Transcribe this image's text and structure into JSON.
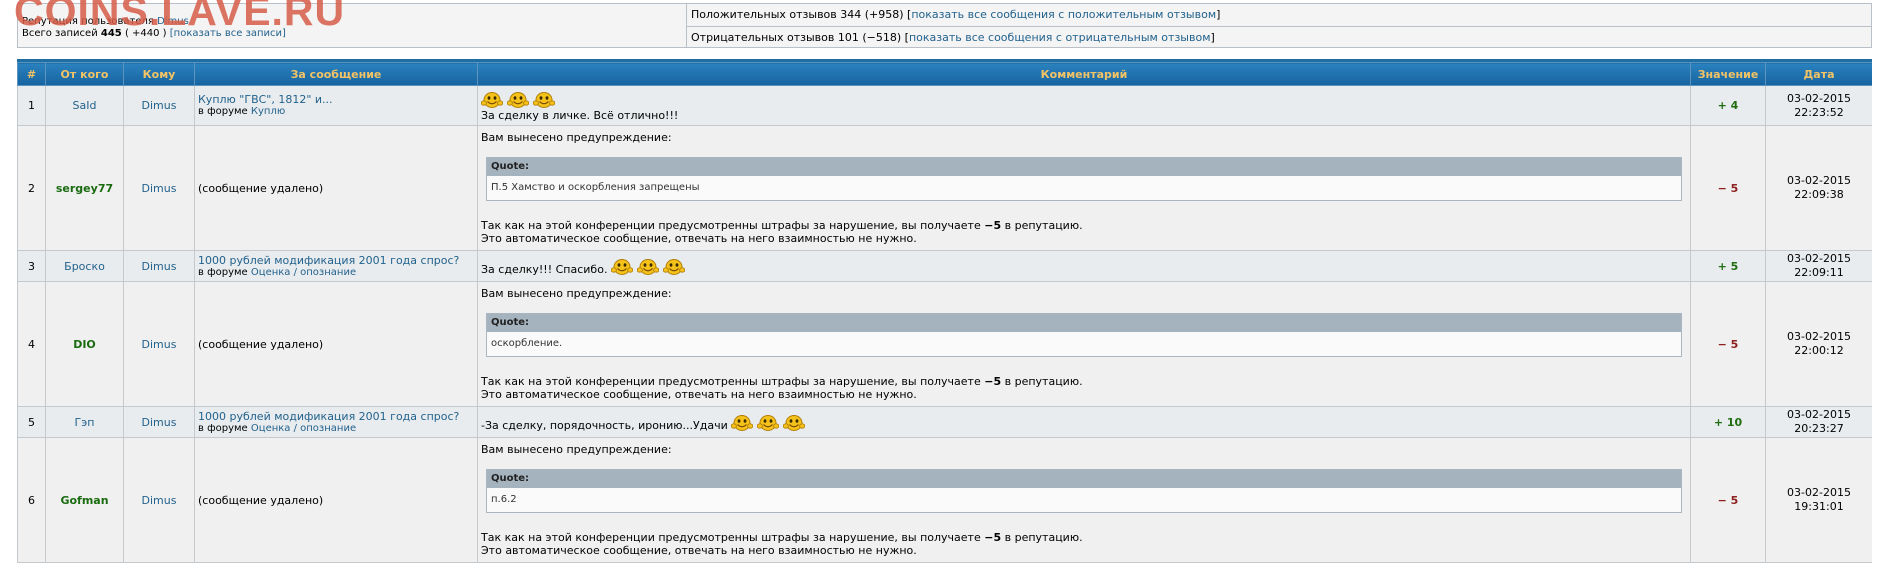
{
  "watermark": "COINS.LAVE.RU",
  "summary": {
    "reputation_label": "Репутация пользователя",
    "reputation_user": "Dimus",
    "total_label": "Всего записей",
    "total_count": "445",
    "total_delta": "( +440 )",
    "show_all_link": "[показать все записи]",
    "positive_text": "Положительных отзывов 344 (+958)",
    "positive_link": "показать все сообщения с положительным отзывом",
    "negative_text": "Отрицательных отзывов 101 (−518)",
    "negative_link": "показать все сообщения с отрицательным отзывом"
  },
  "columns": [
    "#",
    "От кого",
    "Кому",
    "За сообщение",
    "Комментарий",
    "Значение",
    "Дата"
  ],
  "rows": [
    {
      "num": "1",
      "from": "SaId",
      "to": "Dimus",
      "msg": "Куплю \"ГВС\", 1812\" и...",
      "forum_prefix": "в форуме",
      "forum": "Куплю",
      "comment": "За сделку в личке. Всё отлично!!!",
      "value": "+ 4",
      "date": "03-02-2015",
      "time": "22:23:52"
    },
    {
      "num": "2",
      "from": "sergey77",
      "to": "Dimus",
      "msg_deleted": "(сообщение удалено)",
      "warn": "Вам вынесено предупреждение:",
      "quote_label": "Quote:",
      "quote": "П.5 Хамство и оскорбления запрещены",
      "penalty_pre": "Так как на этой конференции предусмотренны штрафы за нарушение, вы получаете",
      "penalty_val": "−5",
      "penalty_post": "в репутацию.",
      "auto": "Это автоматическое сообщение, отвечать на него взаимностью не нужно.",
      "value": "− 5",
      "date": "03-02-2015",
      "time": "22:09:38"
    },
    {
      "num": "3",
      "from": "Броско",
      "to": "Dimus",
      "msg": "1000 рублей модификация 2001 года спрос?",
      "forum_prefix": "в форуме",
      "forum": "Оценка / опознание",
      "comment": "За сделку!!! Спасибо.",
      "value": "+ 5",
      "date": "03-02-2015",
      "time": "22:09:11"
    },
    {
      "num": "4",
      "from": "DIO",
      "to": "Dimus",
      "msg_deleted": "(сообщение удалено)",
      "warn": "Вам вынесено предупреждение:",
      "quote_label": "Quote:",
      "quote": "оскорбление.",
      "penalty_pre": "Так как на этой конференции предусмотренны штрафы за нарушение, вы получаете",
      "penalty_val": "−5",
      "penalty_post": "в репутацию.",
      "auto": "Это автоматическое сообщение, отвечать на него взаимностью не нужно.",
      "value": "− 5",
      "date": "03-02-2015",
      "time": "22:00:12"
    },
    {
      "num": "5",
      "from": "Гэп",
      "to": "Dimus",
      "msg": "1000 рублей модификация 2001 года спрос?",
      "forum_prefix": "в форуме",
      "forum": "Оценка / опознание",
      "comment": "-За сделку, порядочность, иронию...Удачи",
      "value": "+ 10",
      "date": "03-02-2015",
      "time": "20:23:27"
    },
    {
      "num": "6",
      "from": "Gofman",
      "to": "Dimus",
      "msg_deleted": "(сообщение удалено)",
      "warn": "Вам вынесено предупреждение:",
      "quote_label": "Quote:",
      "quote": "п.6.2",
      "penalty_pre": "Так как на этой конференции предусмотренны штрафы за нарушение, вы получаете",
      "penalty_val": "−5",
      "penalty_post": "в репутацию.",
      "auto": "Это автоматическое сообщение, отвечать на него взаимностью не нужно.",
      "value": "− 5",
      "date": "03-02-2015",
      "time": "19:31:01"
    }
  ],
  "icons": {
    "smiley": "clapping-smiley-icon"
  },
  "colors": {
    "header_bg": "#1d6ea3",
    "header_text": "#f3c365",
    "positive": "#1f6d10",
    "negative": "#8e2020",
    "link": "#22628d"
  }
}
